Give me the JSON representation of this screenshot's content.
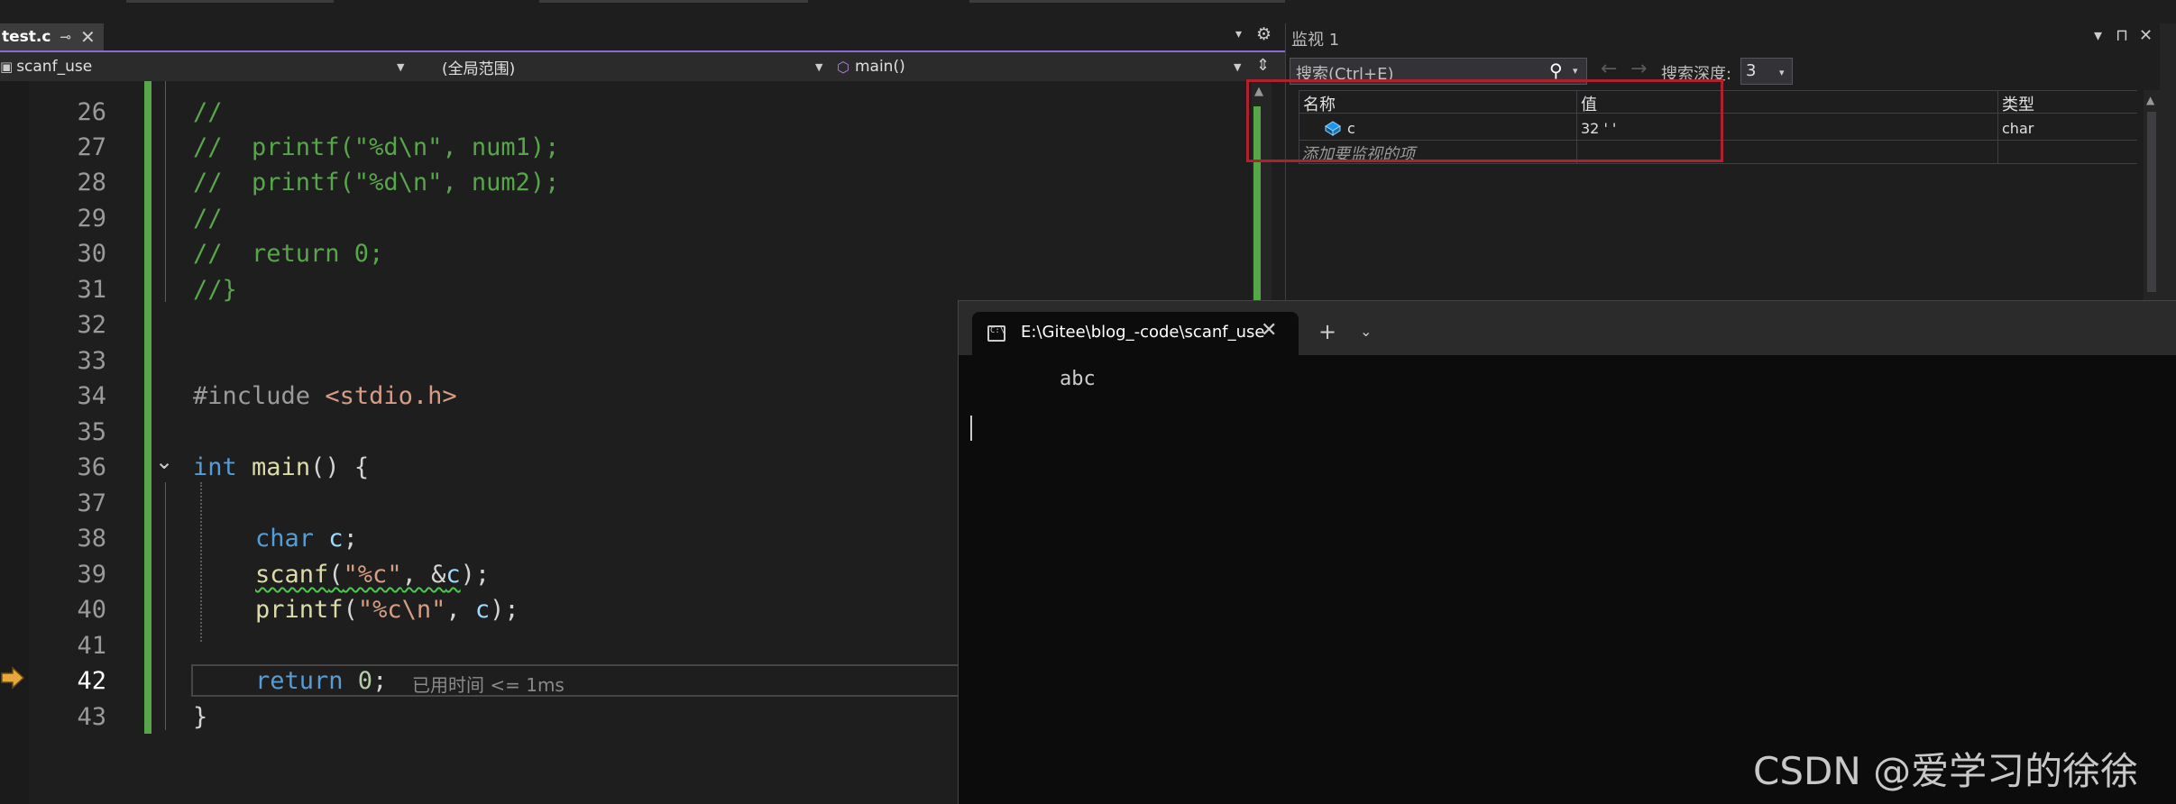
{
  "editor": {
    "file_tab": {
      "name": "test.c",
      "pin": "⊸",
      "close": "✕"
    },
    "tabbar_menu": "▾",
    "tabbar_gear": "⚙",
    "nav": {
      "project": "scanf_use",
      "scope": "(全局范围)",
      "function": "main()",
      "split_icon": "⇕"
    },
    "line_numbers": [
      "26",
      "27",
      "28",
      "29",
      "30",
      "31",
      "32",
      "33",
      "34",
      "35",
      "36",
      "37",
      "38",
      "39",
      "40",
      "41",
      "42",
      "43"
    ],
    "code_lines": {
      "l26": "//",
      "l27": "//  printf(\"%d\\n\", num1);",
      "l28": "//  printf(\"%d\\n\", num2);",
      "l29": "//",
      "l30": "//  return 0;",
      "l31": "//}",
      "l34_pre": "#include ",
      "l34_hdr": "<stdio.h>",
      "l36_kw": "int",
      "l36_fn": "main",
      "l36_rest": "() {",
      "l38_kw": "char",
      "l38_var": "c",
      "l38_rest": ";",
      "l39_fn": "scanf",
      "l39_p1": "(",
      "l39_str": "\"%c\"",
      "l39_p2": ", &",
      "l39_var": "c",
      "l39_p3": ");",
      "l40_fn": "printf",
      "l40_p1": "(",
      "l40_str": "\"%c\\n\"",
      "l40_p2": ", ",
      "l40_var": "c",
      "l40_p3": ");",
      "l42_kw": "return",
      "l42_num": " 0",
      "l42_rest": ";",
      "l43": "}"
    },
    "elapsed_hint": "已用时间 <= 1ms",
    "fold_icon": "⌄"
  },
  "watch": {
    "title": "监视 1",
    "window_buttons": {
      "menu": "▾",
      "pin": "⊓",
      "close": "✕"
    },
    "search_placeholder": "搜索(Ctrl+E)",
    "search_icon": "⚲",
    "search_dropdown": "▾",
    "nav_back": "←",
    "nav_forward": "→",
    "depth_label": "搜索深度:",
    "depth_value": "3",
    "depth_arrow": "▾",
    "columns": {
      "name": "名称",
      "value": "值",
      "type": "类型"
    },
    "rows": [
      {
        "name": "c",
        "value": "32 ' '",
        "type": "char"
      }
    ],
    "add_watch": "添加要监视的项"
  },
  "terminal": {
    "tab_title": "E:\\Gitee\\blog_-code\\scanf_use",
    "tab_close": "✕",
    "new_tab": "+",
    "dropdown": "⌄",
    "output_line": "abc"
  },
  "watermark": "CSDN @爱学习的徐徐",
  "colors": {
    "editor_bg": "#1e1e1e",
    "comment": "#57a64a",
    "keyword": "#569cd6",
    "function": "#dcdcaa",
    "string": "#d69d85",
    "variable": "#9cdcfe",
    "accent_tab": "#8c6ad1",
    "highlight_box": "#b0202e",
    "terminal_bg": "#0c0c0c"
  }
}
